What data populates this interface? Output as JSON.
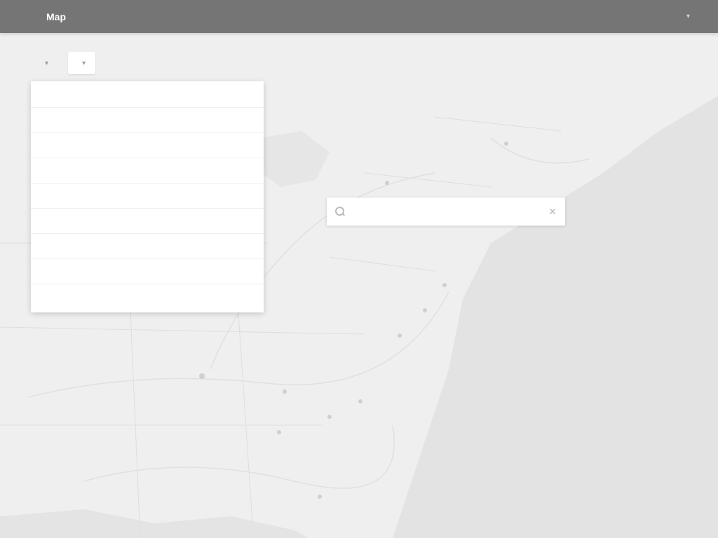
{
  "nav": {
    "brand": "",
    "links": [
      {
        "label": "Map",
        "active": true
      },
      {
        "label": "",
        "active": false
      },
      {
        "label": "",
        "active": false
      }
    ],
    "account_label": ""
  },
  "filters": {
    "first_label": "",
    "second_label": ""
  },
  "dropdown": {
    "items": [
      "",
      "",
      "",
      "",
      "",
      "",
      "",
      "",
      ""
    ]
  },
  "search": {
    "value": "",
    "placeholder": ""
  },
  "map": {
    "labels": []
  },
  "colors": {
    "nav_bg": "#757575",
    "map_land": "#efefef",
    "map_water": "#e3e3e3",
    "dropdown_bg": "#ffffff"
  }
}
